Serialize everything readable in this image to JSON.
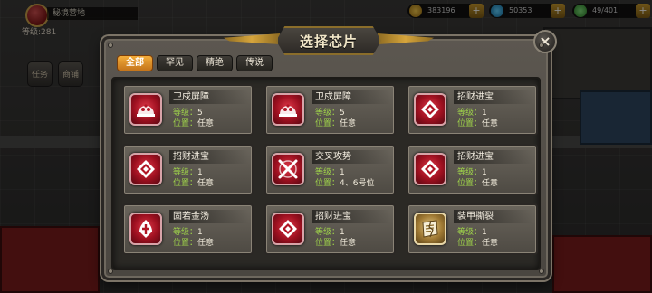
{
  "hud": {
    "base_name": "秘境营地",
    "level_label": "等级:281",
    "gold": "383196",
    "gems": "50353",
    "population": "49/401",
    "plus": "+",
    "side_task": "任务",
    "side_store": "商铺"
  },
  "dialog": {
    "title": "选择芯片",
    "close_glyph": "×",
    "tabs": [
      {
        "label": "全部"
      },
      {
        "label": "罕见"
      },
      {
        "label": "精绝"
      },
      {
        "label": "传说"
      }
    ],
    "level_label": "等级：",
    "position_label": "位置：",
    "chips": [
      {
        "name": "卫戍屏障",
        "level": "5",
        "position": "任意",
        "icon": "dome-shield-icon"
      },
      {
        "name": "卫戍屏障",
        "level": "5",
        "position": "任意",
        "icon": "dome-shield-icon"
      },
      {
        "name": "招财进宝",
        "level": "1",
        "position": "任意",
        "icon": "treasure-diamond-icon"
      },
      {
        "name": "招财进宝",
        "level": "1",
        "position": "任意",
        "icon": "treasure-diamond-icon"
      },
      {
        "name": "交叉攻势",
        "level": "1",
        "position": "4、6号位",
        "icon": "crossed-blades-icon"
      },
      {
        "name": "招财进宝",
        "level": "1",
        "position": "任意",
        "icon": "treasure-diamond-icon"
      },
      {
        "name": "固若金汤",
        "level": "1",
        "position": "任意",
        "icon": "fortress-emblem-icon"
      },
      {
        "name": "招财进宝",
        "level": "1",
        "position": "任意",
        "icon": "treasure-diamond-icon"
      },
      {
        "name": "装甲撕裂",
        "level": "1",
        "position": "任意",
        "icon": "torn-scroll-icon"
      }
    ]
  }
}
